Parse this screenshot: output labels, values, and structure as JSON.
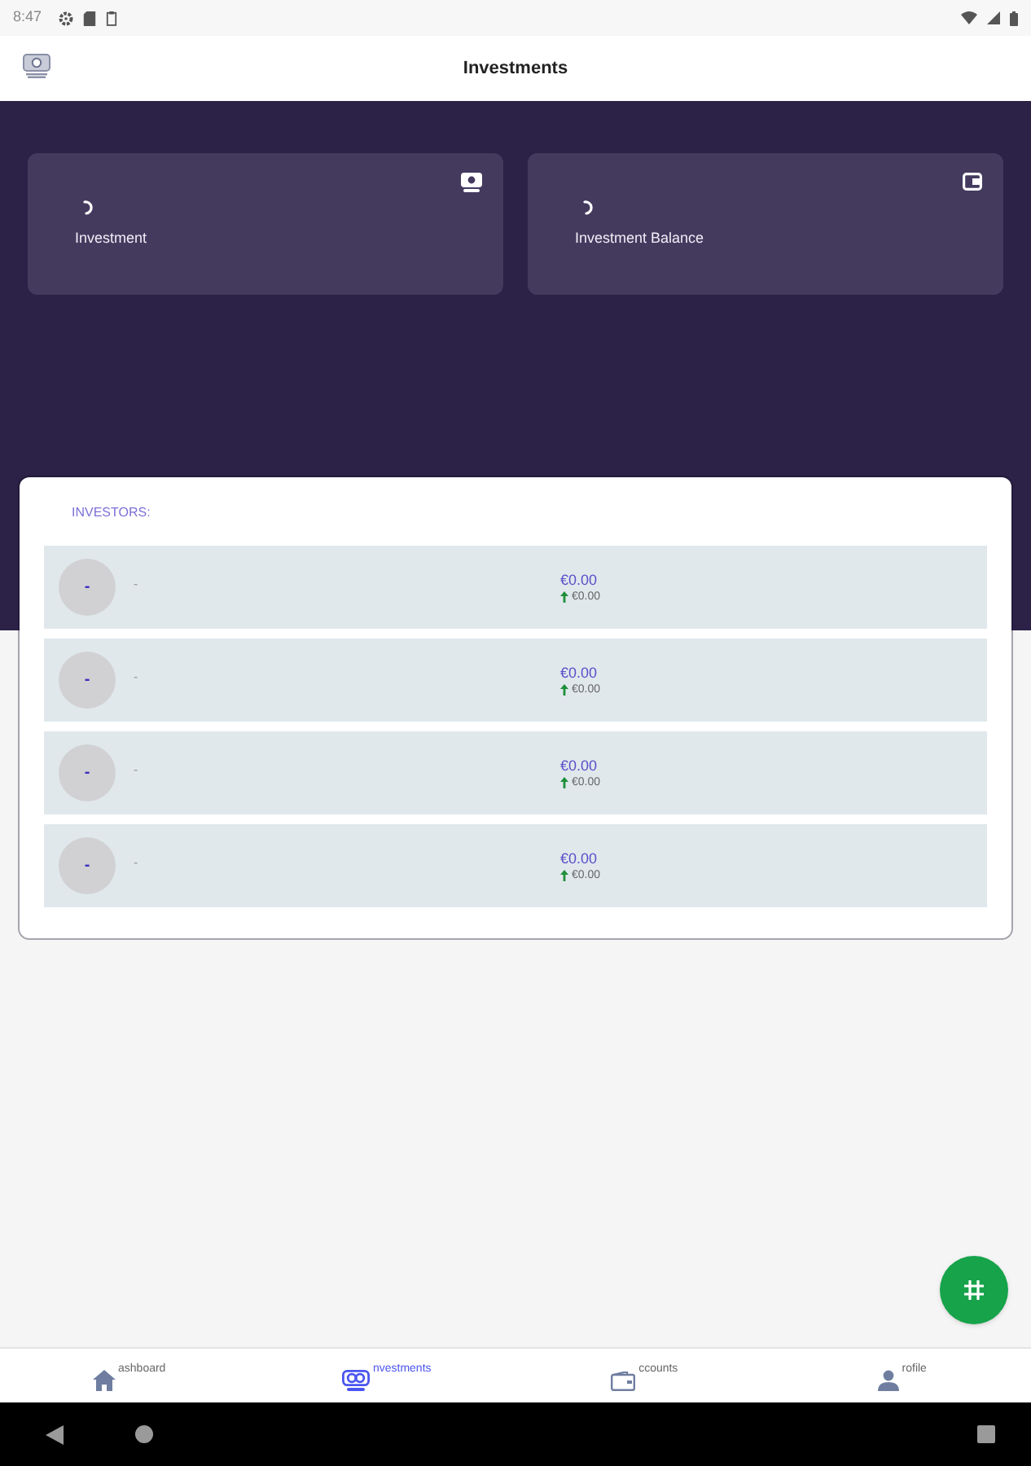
{
  "status_bar": {
    "time": "8:47"
  },
  "app_bar": {
    "title": "Investments"
  },
  "summary_cards": [
    {
      "label": "Investment",
      "loading": true
    },
    {
      "label": "Investment Balance",
      "loading": true
    }
  ],
  "investors": {
    "heading": "INVESTORS:",
    "rows": [
      {
        "avatar_text": "-",
        "name": "-",
        "amount": "€0.00",
        "change": "€0.00"
      },
      {
        "avatar_text": "-",
        "name": "-",
        "amount": "€0.00",
        "change": "€0.00"
      },
      {
        "avatar_text": "-",
        "name": "-",
        "amount": "€0.00",
        "change": "€0.00"
      },
      {
        "avatar_text": "-",
        "name": "-",
        "amount": "€0.00",
        "change": "€0.00"
      }
    ]
  },
  "bottom_nav": [
    {
      "label": "ashboard",
      "selected": false
    },
    {
      "label": "nvestments",
      "selected": true
    },
    {
      "label": "ccounts",
      "selected": false
    },
    {
      "label": "rofile",
      "selected": false
    }
  ]
}
